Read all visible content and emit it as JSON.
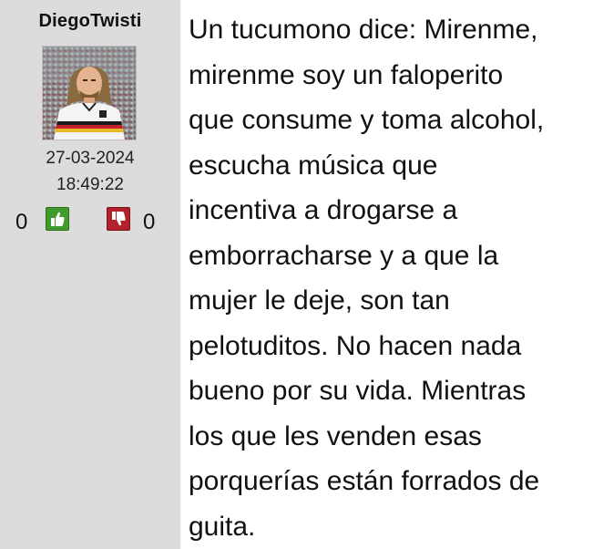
{
  "post": {
    "username": "DiegoTwisti",
    "date": "27-03-2024",
    "time": "18:49:22",
    "likes": "0",
    "dislikes": "0",
    "message": "Un tucumono dice: Mirenme,\nmirenme soy un faloperito\nque consume y toma alcohol,\nescucha música que\nincentiva a drogarse a\nemborracharse y a que la\nmujer le deje, son tan\npelotuditos. No hacen nada\nbueno por su vida. Mientras\nlos que les venden esas\nporquerías están forrados de\nguita."
  },
  "icons": {
    "like": "thumbs-up-icon",
    "dislike": "thumbs-down-icon"
  },
  "colors": {
    "sidebar_bg": "#dcdcdc",
    "like_green": "#3f9c2b",
    "dislike_red": "#b3212d"
  }
}
